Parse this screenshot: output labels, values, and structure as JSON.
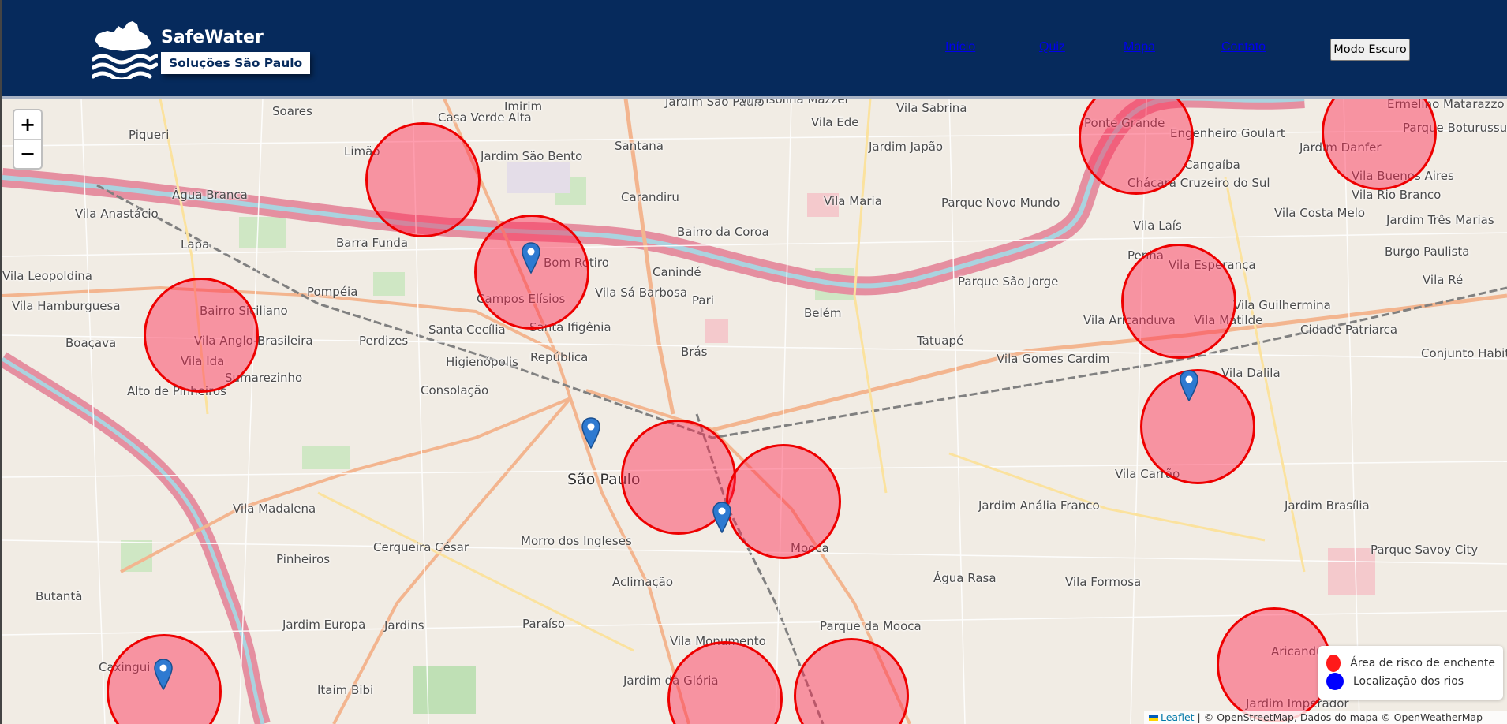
{
  "brand": {
    "name": "SafeWater",
    "subtitle": "Soluções São Paulo"
  },
  "nav": {
    "items": [
      "Início",
      "Quiz",
      "Mapa",
      "Contato"
    ],
    "dark_mode_label": "Modo Escuro"
  },
  "map": {
    "zoom_in": "+",
    "zoom_out": "−",
    "legend": {
      "flood_risk": "Área de risco de enchente",
      "flood_risk_color": "#ff1a1a",
      "rivers": "Localização dos rios",
      "rivers_color": "#0000ff"
    },
    "attribution": {
      "leaflet": "Leaflet",
      "rest": " | © OpenStreetMap, Dados do mapa © OpenWeatherMap"
    },
    "place_labels": [
      "Imirim",
      "Jardim São Paulo",
      "Vila Isolina Mazzei",
      "Vila Ede",
      "Vila Sabrina",
      "Ermelino Matarazzo",
      "Soares",
      "Casa Verde Alta",
      "Piqueri",
      "Limão",
      "Jardim São Bento",
      "Santana",
      "Ponte Grande",
      "Engenheiro Goulart",
      "Jardim Japão",
      "Jardim Danfer",
      "Parque Boturussu",
      "Água Branca",
      "Carandiru",
      "Cangaíba",
      "Chácara Cruzeiro do Sul",
      "Vila Buenos Aires",
      "Vila Anastácio",
      "Vila Maria",
      "Parque Novo Mundo",
      "Vila Rio Branco",
      "Vila Costa Melo",
      "Jardim Três Marias",
      "Lapa",
      "Barra Funda",
      "Bairro da Coroa",
      "Vila Laís",
      "Penha",
      "Burgo Paulista",
      "Vila Leopoldina",
      "Bom Retiro",
      "Canindé",
      "Vila Esperança",
      "Parque São Jorge",
      "Vila Ré",
      "Vila Hamburguesa",
      "Pompéia",
      "Campos Elísios",
      "Vila Sá Barbosa",
      "Pari",
      "Belém",
      "Vila Guilhermina",
      "Bairro Siciliano",
      "Santa Cecília",
      "Santa Ifigênia",
      "Vila Aricanduva",
      "Vila Matilde",
      "Cidade Patriarca",
      "Boaçava",
      "Vila Anglo-Brasileira",
      "Perdizes",
      "Tatuapé",
      "Conjunto Habitacional Padre Manoel da Nóbrega",
      "Vila Ida",
      "Higienópolis",
      "República",
      "Brás",
      "Vila Gomes Cardim",
      "Vila Dalila",
      "Sumarezinho",
      "Alto de Pinheiros",
      "Consolação",
      "São Paulo",
      "Vila Carrão",
      "Jardim Brasília",
      "Vila Madalena",
      "Jardim Anália Franco",
      "Cerqueira César",
      "Morro dos Ingleses",
      "Mooca",
      "Pinheiros",
      "Parque Savoy City",
      "Água Rasa",
      "Butantã",
      "Aclimação",
      "Vila Formosa",
      "Jardim Europa",
      "Jardins",
      "Paraíso",
      "Parque da Mooca",
      "Aricanduva",
      "Vila Monumento",
      "Caxingui",
      "Itaim Bibi",
      "Jardim da Glória",
      "Jardim Imperador"
    ]
  }
}
